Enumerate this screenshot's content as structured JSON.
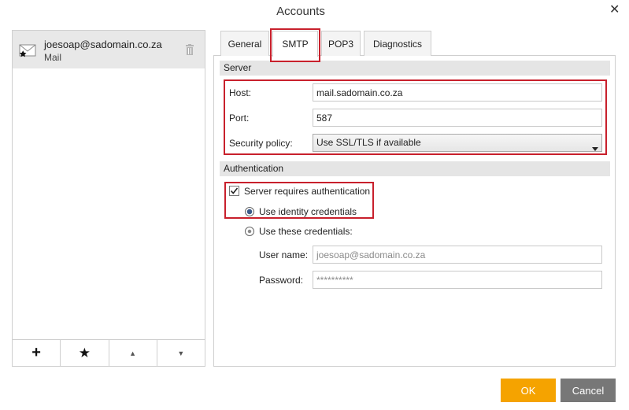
{
  "window": {
    "title": "Accounts",
    "close_glyph": "✕"
  },
  "accounts": [
    {
      "email": "joesoap@sadomain.co.za",
      "type": "Mail",
      "icon": "mail-envelope-icon"
    }
  ],
  "account_toolbar": {
    "add": "+",
    "default": "★",
    "move_up": "▲",
    "move_down": "▼"
  },
  "tabs": [
    {
      "label": "General"
    },
    {
      "label": "SMTP",
      "active": true
    },
    {
      "label": "POP3"
    },
    {
      "label": "Diagnostics"
    }
  ],
  "server": {
    "heading": "Server",
    "host_label": "Host:",
    "host_value": "mail.sadomain.co.za",
    "port_label": "Port:",
    "port_value": "587",
    "security_label": "Security policy:",
    "security_value": "Use SSL/TLS if available"
  },
  "authentication": {
    "heading": "Authentication",
    "requires_auth_label": "Server requires authentication",
    "requires_auth_checked": true,
    "use_identity_label": "Use identity credentials",
    "use_these_label": "Use these credentials:",
    "username_label": "User name:",
    "username_value": "joesoap@sadomain.co.za",
    "password_label": "Password:",
    "password_value": "**********"
  },
  "buttons": {
    "ok": "OK",
    "cancel": "Cancel"
  },
  "colors": {
    "ok": "#f5a300",
    "cancel": "#777777",
    "highlight": "#c8202c"
  }
}
